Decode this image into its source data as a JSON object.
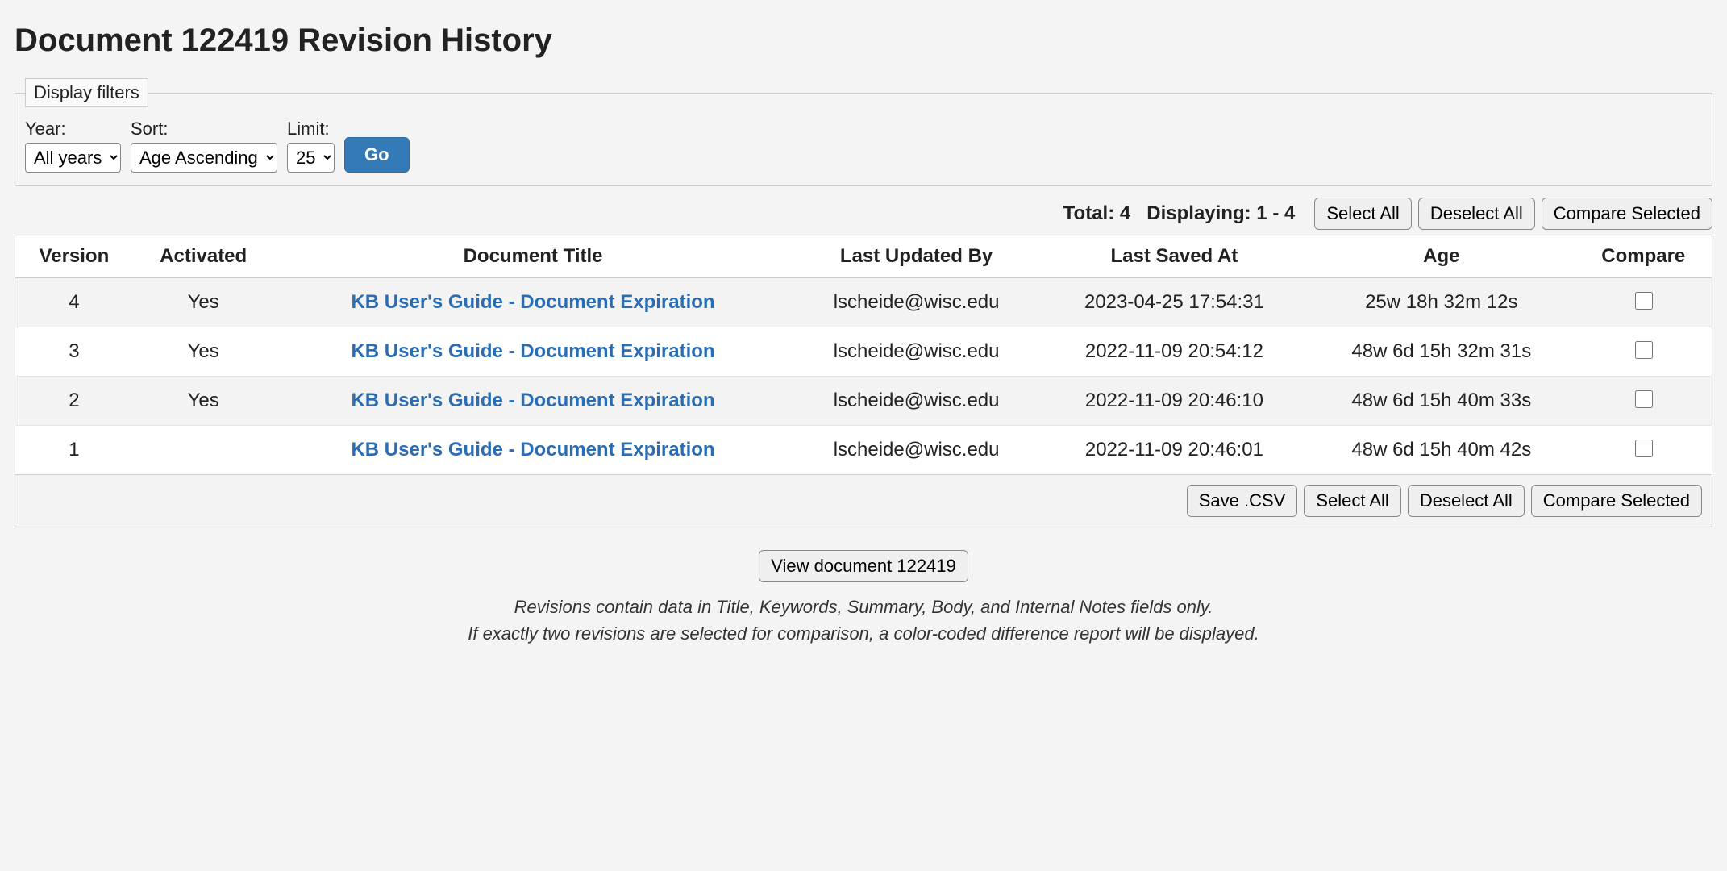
{
  "page": {
    "title": "Document 122419 Revision History"
  },
  "filters": {
    "legend": "Display filters",
    "year": {
      "label": "Year:",
      "value": "All years"
    },
    "sort": {
      "label": "Sort:",
      "value": "Age Ascending"
    },
    "limit": {
      "label": "Limit:",
      "value": "25"
    },
    "go": "Go"
  },
  "summary": {
    "total_label": "Total: ",
    "total": "4",
    "displaying_label": "Displaying: ",
    "displaying": "1 - 4"
  },
  "toolbar": {
    "select_all": "Select All",
    "deselect_all": "Deselect All",
    "compare_selected": "Compare Selected",
    "save_csv": "Save .CSV",
    "view_document": "View document 122419"
  },
  "table": {
    "headers": {
      "version": "Version",
      "activated": "Activated",
      "title": "Document Title",
      "updated_by": "Last Updated By",
      "saved_at": "Last Saved At",
      "age": "Age",
      "compare": "Compare"
    },
    "rows": [
      {
        "version": "4",
        "activated": "Yes",
        "title": "KB User's Guide - Document Expiration",
        "updated_by": "lscheide@wisc.edu",
        "saved_at": "2023-04-25 17:54:31",
        "age": "25w 18h 32m 12s"
      },
      {
        "version": "3",
        "activated": "Yes",
        "title": "KB User's Guide - Document Expiration",
        "updated_by": "lscheide@wisc.edu",
        "saved_at": "2022-11-09 20:54:12",
        "age": "48w 6d 15h 32m 31s"
      },
      {
        "version": "2",
        "activated": "Yes",
        "title": "KB User's Guide - Document Expiration",
        "updated_by": "lscheide@wisc.edu",
        "saved_at": "2022-11-09 20:46:10",
        "age": "48w 6d 15h 40m 33s"
      },
      {
        "version": "1",
        "activated": "",
        "title": "KB User's Guide - Document Expiration",
        "updated_by": "lscheide@wisc.edu",
        "saved_at": "2022-11-09 20:46:01",
        "age": "48w 6d 15h 40m 42s"
      }
    ]
  },
  "notes": {
    "line1": "Revisions contain data in Title, Keywords, Summary, Body, and Internal Notes fields only.",
    "line2": "If exactly two revisions are selected for comparison, a color-coded difference report will be displayed."
  }
}
